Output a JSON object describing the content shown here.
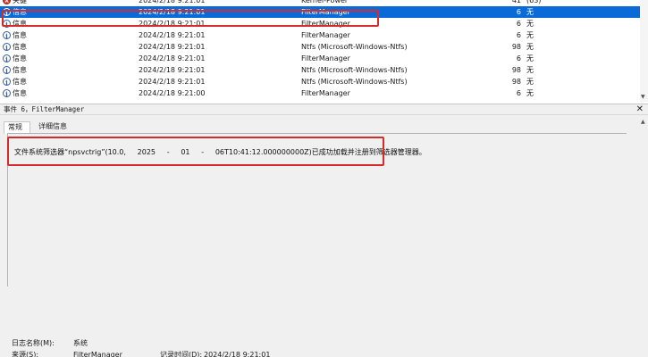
{
  "colors": {
    "selection": "#0a6ad8",
    "highlight_box": "#d62b2b",
    "info_icon": "#2f5fa8",
    "critical_icon": "#d23a2c"
  },
  "event_list": {
    "rows": [
      {
        "level_icon": "critical-icon",
        "level": "关键",
        "date": "2024/2/18 9:21:01",
        "source": "Kernel-Power",
        "event_id": "41",
        "task": "(63)"
      },
      {
        "level_icon": "info-icon",
        "level": "信息",
        "date": "2024/2/18 9:21:01",
        "source": "FilterManager",
        "event_id": "6",
        "task": "无"
      },
      {
        "level_icon": "info-icon",
        "level": "信息",
        "date": "2024/2/18 9:21:01",
        "source": "FilterManager",
        "event_id": "6",
        "task": "无"
      },
      {
        "level_icon": "info-icon",
        "level": "信息",
        "date": "2024/2/18 9:21:01",
        "source": "FilterManager",
        "event_id": "6",
        "task": "无"
      },
      {
        "level_icon": "info-icon",
        "level": "信息",
        "date": "2024/2/18 9:21:01",
        "source": "Ntfs (Microsoft-Windows-Ntfs)",
        "event_id": "98",
        "task": "无"
      },
      {
        "level_icon": "info-icon",
        "level": "信息",
        "date": "2024/2/18 9:21:01",
        "source": "FilterManager",
        "event_id": "6",
        "task": "无"
      },
      {
        "level_icon": "info-icon",
        "level": "信息",
        "date": "2024/2/18 9:21:01",
        "source": "Ntfs (Microsoft-Windows-Ntfs)",
        "event_id": "98",
        "task": "无"
      },
      {
        "level_icon": "info-icon",
        "level": "信息",
        "date": "2024/2/18 9:21:01",
        "source": "Ntfs (Microsoft-Windows-Ntfs)",
        "event_id": "98",
        "task": "无"
      },
      {
        "level_icon": "info-icon",
        "level": "信息",
        "date": "2024/2/18 9:21:00",
        "source": "FilterManager",
        "event_id": "6",
        "task": "无"
      }
    ],
    "selected_index": 1
  },
  "detail": {
    "title": "事件 6，FilterManager",
    "tabs": [
      {
        "label": "常规"
      },
      {
        "label": "详细信息"
      }
    ],
    "message": "文件系统筛选器“npsvctrig”(10.0,     2025     -     01     -     06T10:41:12.000000000Z)已成功加载并注册到筛选器管理器。",
    "log_name_label": "日志名称(M):",
    "log_name_value": "系统",
    "source_label": "来源(S):",
    "source_value": "FilterManager",
    "logged_label": "记录时间(D):",
    "logged_value": "2024/2/18 9:21:01"
  }
}
